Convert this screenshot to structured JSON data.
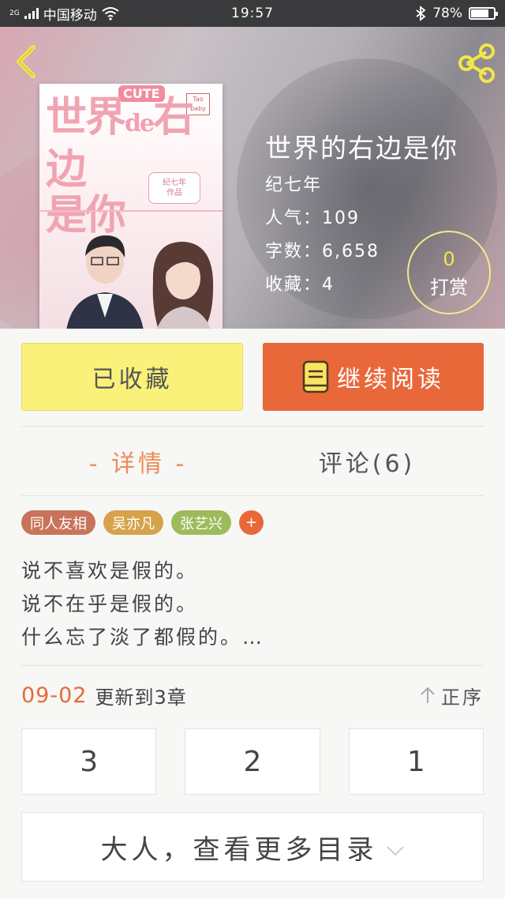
{
  "status_bar": {
    "network_label": "中国移动",
    "network_type": "2G",
    "time": "19:57",
    "battery_percent": "78%",
    "battery_level": 0.78
  },
  "book": {
    "title": "世界的右边是你",
    "author": "纪七年",
    "popularity": "人气：109",
    "word_count": "字数：6,658",
    "favorites": "收藏：4",
    "cover": {
      "title_line1": "世界",
      "title_de": "de",
      "title_line1b": "右边",
      "title_line2": "是你",
      "cute_label": "CUTE",
      "tao_label": "Tao baby",
      "badge_line1": "纪七年",
      "badge_line2": "作品"
    }
  },
  "tip": {
    "count": "0",
    "label": "打赏"
  },
  "actions": {
    "collected_label": "已收藏",
    "continue_label": "继续阅读"
  },
  "tabs": {
    "detail_label": "- 详情 -",
    "comments_label": "评论(6)"
  },
  "tags": [
    {
      "label": "同人友相",
      "color": "#c8735a"
    },
    {
      "label": "吴亦凡",
      "color": "#d6a24a"
    },
    {
      "label": "张艺兴",
      "color": "#9cbb5a"
    }
  ],
  "tag_more": "+",
  "synopsis": {
    "line1": "说不喜欢是假的。",
    "line2": "说不在乎是假的。",
    "line3": "什么忘了淡了都假的。…"
  },
  "update": {
    "date": "09-02",
    "text": "更新到3章",
    "sort_label": "正序"
  },
  "chapters": [
    "3",
    "2",
    "1"
  ],
  "more_toc_label": "大人，查看更多目录",
  "colors": {
    "accent_orange": "#e8683a",
    "collected_yellow": "#faf17b",
    "tip_yellow": "#f6e44a"
  },
  "icons": {
    "back": "chevron-left-icon",
    "share": "share-icon",
    "book": "book-icon",
    "sort": "arrow-up-icon",
    "expand": "chevron-down-icon"
  }
}
